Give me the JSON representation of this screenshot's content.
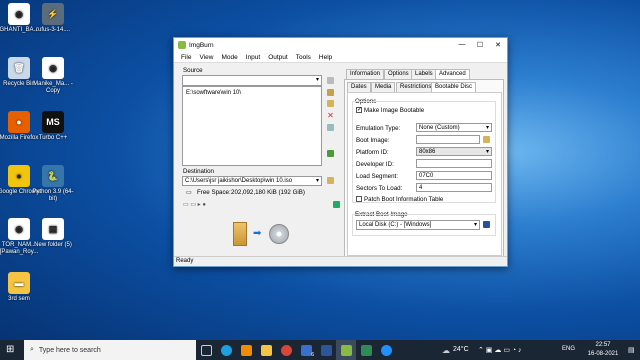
{
  "desktop": {
    "icons": [
      {
        "label": "GHANTI_BA...",
        "color": "#ffffff",
        "glyph": "◉"
      },
      {
        "label": "rufus-3-14....",
        "color": "#5b6d7d",
        "glyph": "⚡"
      },
      {
        "label": "Recycle Bin",
        "color": "#c9d9ea",
        "glyph": "🗑"
      },
      {
        "label": "Manike_Ma... - Copy",
        "color": "#ffffff",
        "glyph": "◉"
      },
      {
        "label": "Mozilla Firefox",
        "color": "#e66000",
        "glyph": "●"
      },
      {
        "label": "Turbo C++",
        "color": "#111111",
        "glyph": "MS"
      },
      {
        "label": "Google Chrome",
        "color": "#f1c40f",
        "glyph": "●"
      },
      {
        "label": "Python 3.9 (64-bit)",
        "color": "#3776ab",
        "glyph": "🐍"
      },
      {
        "label": "TOR_NAM... [Pawan_Roy...",
        "color": "#ffffff",
        "glyph": "◉"
      },
      {
        "label": "New folder (5)",
        "color": "#ffffff",
        "glyph": "▤"
      },
      {
        "label": "3rd sem",
        "color": "#f4c542",
        "glyph": "▬"
      }
    ]
  },
  "window": {
    "title": "ImgBurn",
    "menu": [
      "File",
      "View",
      "Mode",
      "Input",
      "Output",
      "Tools",
      "Help"
    ],
    "source_label": "Source",
    "source_path": "E:\\sowftware\\win 10\\",
    "destination_label": "Destination",
    "destination_path": "C:\\Users\\jsr jaikishor\\Desktop\\win 10.iso",
    "free_space_label": "Free Space:",
    "free_space_value": "202,092,180 KiB  (192 GiB)",
    "status": "Ready",
    "tabs_top": [
      "Information",
      "Options",
      "Labels",
      "Advanced"
    ],
    "tabs_bottom": [
      "Dates",
      "Media",
      "Restrictions",
      "Bootable Disc"
    ],
    "options_group": "Options",
    "make_bootable": "Make Image Bootable",
    "emulation_type_label": "Emulation Type:",
    "emulation_type_value": "None (Custom)",
    "boot_image_label": "Boot Image:",
    "boot_image_value": "",
    "platform_id_label": "Platform ID:",
    "platform_id_value": "80x86",
    "developer_id_label": "Developer ID:",
    "developer_id_value": "",
    "load_segment_label": "Load Segment:",
    "load_segment_value": "07C0",
    "sectors_label": "Sectors To Load:",
    "sectors_value": "4",
    "patch_label": "Patch Boot Information Table",
    "extract_group": "Extract Boot Image",
    "extract_value": "Local Disk (C:) - [Windows]"
  },
  "taskbar": {
    "search_placeholder": "Type here to search",
    "weather": "24°C",
    "language": "ENG",
    "time": "22:57",
    "date": "16-08-2021",
    "notification_count": "6"
  }
}
